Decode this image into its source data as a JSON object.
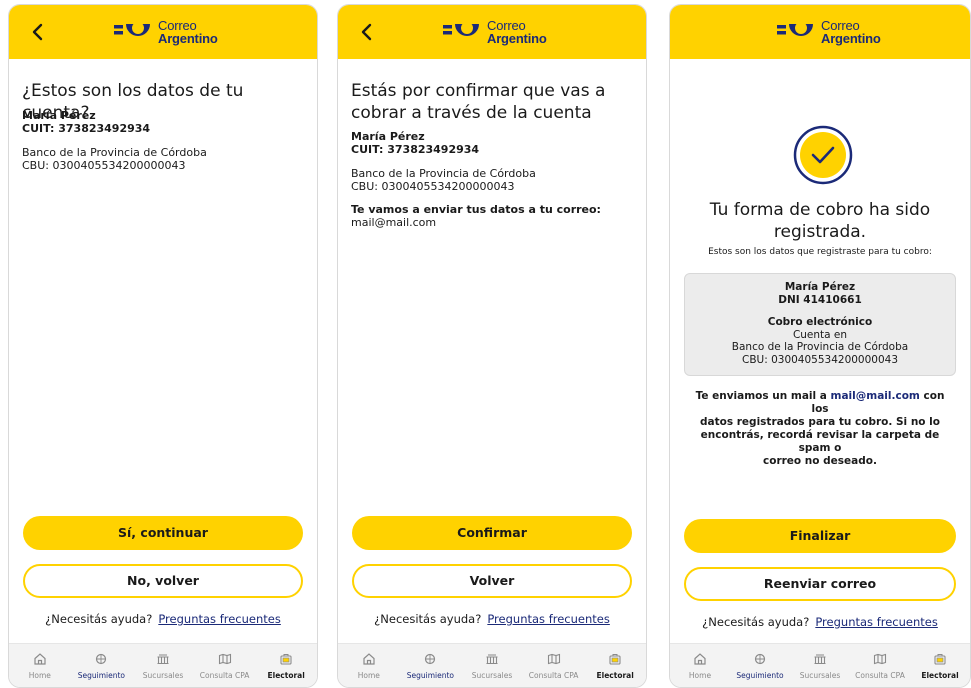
{
  "brand": {
    "line1": "Correo",
    "line2": "Argentino"
  },
  "colors": {
    "accent": "#ffd200",
    "brand_blue": "#1b2a78"
  },
  "screen1": {
    "title": "¿Estos son los datos de tu cuenta?",
    "name": "María Pérez",
    "cuit": "CUIT: 373823492934",
    "bank": "Banco de la Provincia de Córdoba",
    "cbu": "CBU: 0300405534200000043",
    "primary_btn": "Sí, continuar",
    "secondary_btn": "No, volver"
  },
  "screen2": {
    "title_line1": "Estás por confirmar que vas a",
    "title_line2": "cobrar a través de la cuenta",
    "name": "María Pérez",
    "cuit": "CUIT: 373823492934",
    "bank": "Banco de la Provincia de Córdoba",
    "cbu": "CBU: 0300405534200000043",
    "mail_label": "Te vamos a enviar tus datos a tu correo:",
    "mail": "mail@mail.com",
    "primary_btn": "Confirmar",
    "secondary_btn": "Volver"
  },
  "screen3": {
    "title_line1": "Tu forma de cobro ha sido",
    "title_line2": "registrada.",
    "subtitle": "Estos son los datos que registraste para tu cobro:",
    "card": {
      "name": "María Pérez",
      "dni": "DNI 41410661",
      "method": "Cobro electrónico",
      "account": "Cuenta en",
      "bank": "Banco de la Provincia de Córdoba",
      "cbu": "CBU: 0300405534200000043"
    },
    "note_pre": "Te enviamos un mail a ",
    "note_mail": "mail@mail.com",
    "note_post1": " con los",
    "note_line2": "datos registrados para tu cobro. Si no lo",
    "note_line3": "encontrás, recordá revisar la carpeta de spam o",
    "note_line4": "correo no deseado.",
    "primary_btn": "Finalizar",
    "secondary_btn": "Reenviar correo"
  },
  "help": {
    "question": "¿Necesitás ayuda?",
    "link": "Preguntas frecuentes"
  },
  "tabs": [
    {
      "label": "Home",
      "icon": "home-icon"
    },
    {
      "label": "Seguimiento",
      "icon": "tracking-icon"
    },
    {
      "label": "Sucursales",
      "icon": "branch-icon"
    },
    {
      "label": "Consulta CPA",
      "icon": "map-icon"
    },
    {
      "label": "Electoral",
      "icon": "ballot-box-icon",
      "active": true
    }
  ]
}
